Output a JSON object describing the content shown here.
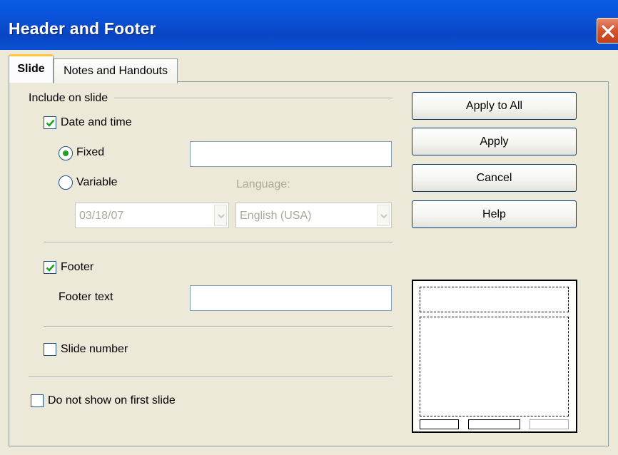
{
  "window": {
    "title": "Header and Footer"
  },
  "tabs": [
    {
      "label": "Slide",
      "active": true
    },
    {
      "label": "Notes and Handouts",
      "active": false
    }
  ],
  "include_section": {
    "label": "Include on slide",
    "date_time": {
      "label": "Date and time",
      "checked": true,
      "fixed": {
        "label": "Fixed",
        "selected": true,
        "value": ""
      },
      "variable": {
        "label": "Variable",
        "selected": false,
        "format_value": "03/18/07",
        "language_label": "Language:",
        "language_value": "English (USA)"
      }
    },
    "footer": {
      "label": "Footer",
      "checked": true,
      "text_label": "Footer text",
      "text_value": ""
    },
    "slide_number": {
      "label": "Slide number",
      "checked": false
    },
    "first_slide": {
      "label": "Do not show on first slide",
      "checked": false
    }
  },
  "buttons": {
    "apply_all": "Apply to All",
    "apply": "Apply",
    "cancel": "Cancel",
    "help": "Help"
  },
  "icons": {
    "close": "close-icon",
    "check": "checkmark-icon",
    "dropdown": "chevron-down-icon"
  },
  "colors": {
    "titlebar": "#0a52d8",
    "close_button": "#d4532d",
    "dialog_bg": "#ece9d8",
    "active_tab_accent": "#ffc83c",
    "check_green": "#21a121"
  }
}
